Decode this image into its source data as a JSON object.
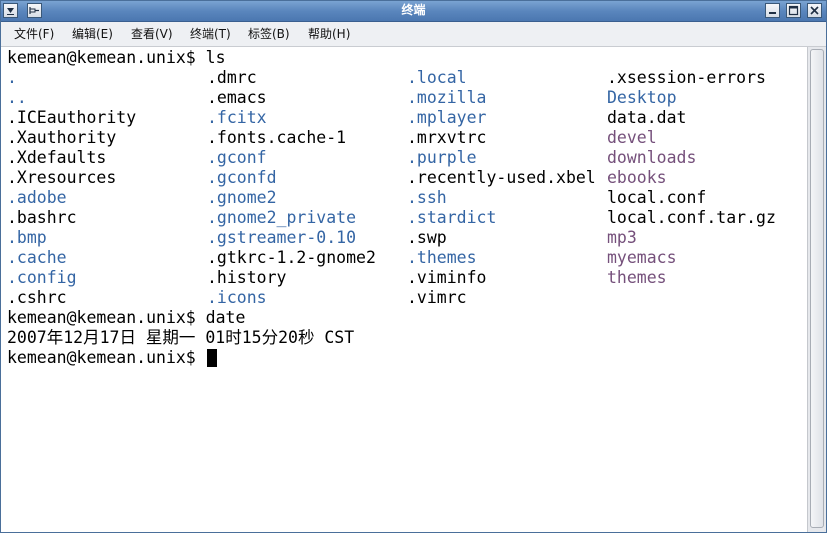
{
  "window": {
    "title": "终端",
    "accent_color": "#5a86bd"
  },
  "menubar": {
    "items": [
      {
        "label": "文件(F)"
      },
      {
        "label": "编辑(E)"
      },
      {
        "label": "查看(V)"
      },
      {
        "label": "终端(T)"
      },
      {
        "label": "标签(B)"
      },
      {
        "label": "帮助(H)"
      }
    ]
  },
  "terminal": {
    "colors": {
      "directory": "#3465a4",
      "file": "#000000",
      "user_dir": "#75507b"
    },
    "prompt_ls": "kemean@kemean.unix$ ls",
    "ls_columns": [
      [
        {
          "name": ".",
          "kind": "dir"
        },
        {
          "name": "..",
          "kind": "dir"
        },
        {
          "name": ".ICEauthority",
          "kind": "file"
        },
        {
          "name": ".Xauthority",
          "kind": "file"
        },
        {
          "name": ".Xdefaults",
          "kind": "file"
        },
        {
          "name": ".Xresources",
          "kind": "file"
        },
        {
          "name": ".adobe",
          "kind": "dir"
        },
        {
          "name": ".bashrc",
          "kind": "file"
        },
        {
          "name": ".bmp",
          "kind": "dir"
        },
        {
          "name": ".cache",
          "kind": "dir"
        },
        {
          "name": ".config",
          "kind": "dir"
        },
        {
          "name": ".cshrc",
          "kind": "file"
        }
      ],
      [
        {
          "name": ".dmrc",
          "kind": "file"
        },
        {
          "name": ".emacs",
          "kind": "file"
        },
        {
          "name": ".fcitx",
          "kind": "dir"
        },
        {
          "name": ".fonts.cache-1",
          "kind": "file"
        },
        {
          "name": ".gconf",
          "kind": "dir"
        },
        {
          "name": ".gconfd",
          "kind": "dir"
        },
        {
          "name": ".gnome2",
          "kind": "dir"
        },
        {
          "name": ".gnome2_private",
          "kind": "dir"
        },
        {
          "name": ".gstreamer-0.10",
          "kind": "dir"
        },
        {
          "name": ".gtkrc-1.2-gnome2",
          "kind": "file"
        },
        {
          "name": ".history",
          "kind": "file"
        },
        {
          "name": ".icons",
          "kind": "dir"
        }
      ],
      [
        {
          "name": ".local",
          "kind": "dir"
        },
        {
          "name": ".mozilla",
          "kind": "dir"
        },
        {
          "name": ".mplayer",
          "kind": "dir"
        },
        {
          "name": ".mrxvtrc",
          "kind": "file"
        },
        {
          "name": ".purple",
          "kind": "dir"
        },
        {
          "name": ".recently-used.xbel",
          "kind": "file"
        },
        {
          "name": ".ssh",
          "kind": "dir"
        },
        {
          "name": ".stardict",
          "kind": "dir"
        },
        {
          "name": ".swp",
          "kind": "file"
        },
        {
          "name": ".themes",
          "kind": "dir"
        },
        {
          "name": ".viminfo",
          "kind": "file"
        },
        {
          "name": ".vimrc",
          "kind": "file"
        }
      ],
      [
        {
          "name": ".xsession-errors",
          "kind": "file"
        },
        {
          "name": "Desktop",
          "kind": "dir"
        },
        {
          "name": "data.dat",
          "kind": "file"
        },
        {
          "name": "devel",
          "kind": "user_dir"
        },
        {
          "name": "downloads",
          "kind": "user_dir"
        },
        {
          "name": "ebooks",
          "kind": "user_dir"
        },
        {
          "name": "local.conf",
          "kind": "file"
        },
        {
          "name": "local.conf.tar.gz",
          "kind": "file"
        },
        {
          "name": "mp3",
          "kind": "user_dir"
        },
        {
          "name": "myemacs",
          "kind": "user_dir"
        },
        {
          "name": "themes",
          "kind": "user_dir"
        }
      ]
    ],
    "prompt_date": "kemean@kemean.unix$ date",
    "date_output": "2007年12月17日 星期一 01时15分20秒 CST",
    "prompt_current": "kemean@kemean.unix$ "
  }
}
